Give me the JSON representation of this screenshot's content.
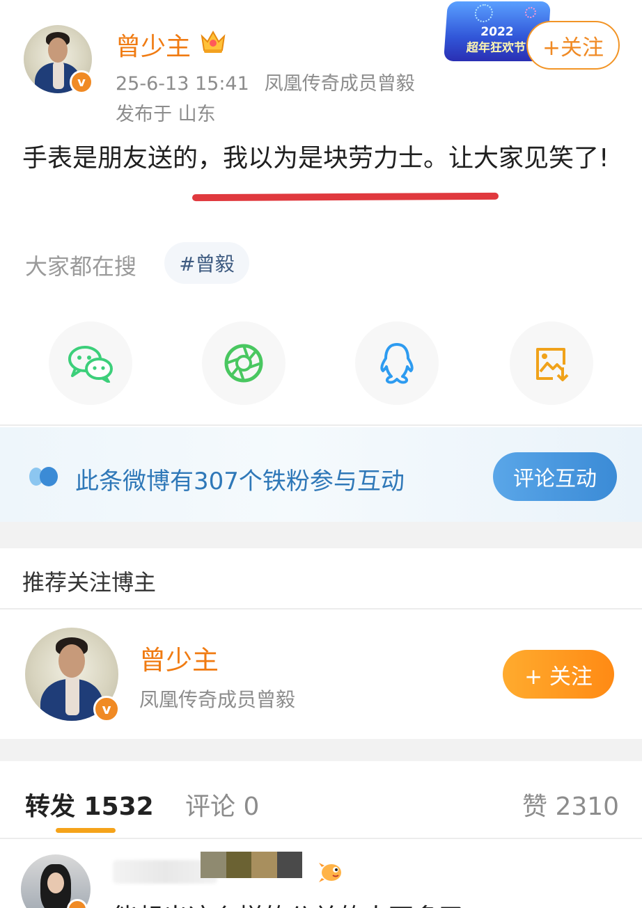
{
  "post": {
    "author": "曾少主",
    "timestamp": "25-6-13 15:41",
    "source": "凤凰传奇成员曾毅",
    "location": "发布于 山东",
    "follow_label": "+关注",
    "text": "手表是朋友送的，我以为是块劳力士。让大家见笑了!",
    "event_banner": {
      "year": "2022",
      "text": "超年狂欢节"
    }
  },
  "search": {
    "label": "大家都在搜",
    "tag": "#曾毅"
  },
  "share": {
    "icons": [
      "wechat-icon",
      "moments-icon",
      "qq-icon",
      "save-image-icon"
    ]
  },
  "fans": {
    "text": "此条微博有307个铁粉参与互动",
    "button": "评论互动"
  },
  "recommend": {
    "title": "推荐关注博主",
    "name": "曾少主",
    "desc": "凤凰传奇成员曾毅",
    "follow_label": "+ 关注"
  },
  "tabs": {
    "repost": "转发 1532",
    "comment": "评论 0",
    "like": "赞 2310"
  },
  "comment_preview": {
    "text": "能想出这么样的公关的人不多了"
  },
  "colors": {
    "accent_orange": "#f07b12",
    "follow_orange": "#ff8a14",
    "link_blue": "#2f78b8",
    "underline_red": "#e0393e"
  }
}
